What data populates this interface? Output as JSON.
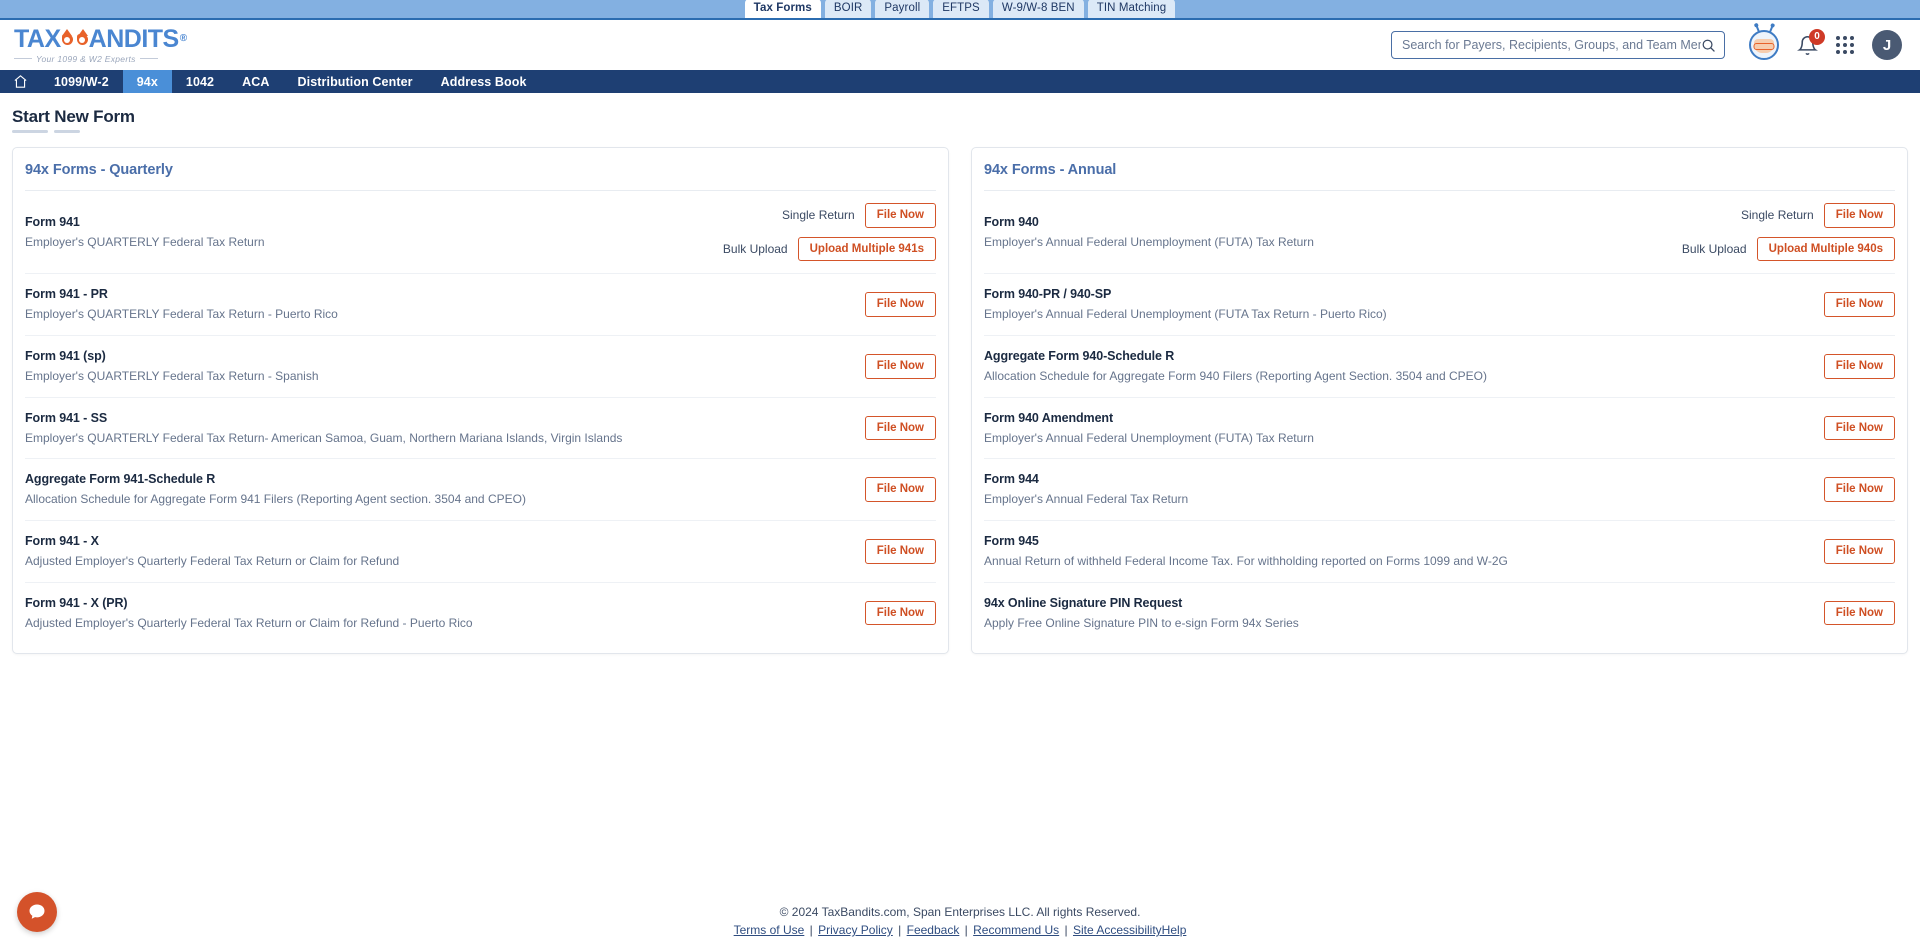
{
  "brand": {
    "name_part1": "TAX",
    "name_part2": "ANDITS",
    "trademark": "Ⓜ",
    "tagline": "Your 1099 & W2 Experts",
    "accent_orange": "#d4552a",
    "accent_blue": "#4a86d1",
    "nav_blue": "#1e3f73"
  },
  "top_tabs": [
    {
      "label": "Tax Forms",
      "active": true
    },
    {
      "label": "BOIR",
      "active": false
    },
    {
      "label": "Payroll",
      "active": false
    },
    {
      "label": "EFTPS",
      "active": false
    },
    {
      "label": "W-9/W-8 BEN",
      "active": false
    },
    {
      "label": "TIN Matching",
      "active": false
    }
  ],
  "header": {
    "search": {
      "placeholder": "Search for Payers, Recipients, Groups, and Team Members",
      "value": "",
      "icon": "search-icon"
    },
    "bot_icon": "bot-assistant-icon",
    "notifications": {
      "icon": "bell-icon",
      "count": "0"
    },
    "apps_icon": "grid-apps-icon",
    "avatar_initial": "J"
  },
  "nav": {
    "home_icon": "home-icon",
    "items": [
      {
        "label": "1099/W-2",
        "active": false
      },
      {
        "label": "94x",
        "active": true
      },
      {
        "label": "1042",
        "active": false
      },
      {
        "label": "ACA",
        "active": false
      },
      {
        "label": "Distribution Center",
        "active": false
      },
      {
        "label": "Address Book",
        "active": false
      }
    ]
  },
  "page": {
    "title": "Start New Form"
  },
  "labels": {
    "single_return": "Single Return",
    "bulk_upload": "Bulk Upload",
    "file_now": "File Now"
  },
  "quarterly": {
    "heading": "94x Forms - Quarterly",
    "rows": [
      {
        "name": "Form 941",
        "desc": "Employer's QUARTERLY Federal Tax Return",
        "single_label": "Single Return",
        "file_now": "File Now",
        "bulk_label": "Bulk Upload",
        "bulk_button": "Upload Multiple 941s"
      },
      {
        "name": "Form 941 - PR",
        "desc": "Employer's QUARTERLY Federal Tax Return - Puerto Rico",
        "file_now": "File Now"
      },
      {
        "name": "Form 941 (sp)",
        "desc": "Employer's QUARTERLY Federal Tax Return - Spanish",
        "file_now": "File Now"
      },
      {
        "name": "Form 941 - SS",
        "desc": "Employer's QUARTERLY Federal Tax Return- American Samoa, Guam, Northern Mariana Islands, Virgin Islands",
        "file_now": "File Now"
      },
      {
        "name": "Aggregate Form 941-Schedule R",
        "desc": "Allocation Schedule for Aggregate Form 941 Filers (Reporting Agent section. 3504 and CPEO)",
        "file_now": "File Now"
      },
      {
        "name": "Form 941 - X",
        "desc": "Adjusted Employer's Quarterly Federal Tax Return or Claim for Refund",
        "file_now": "File Now"
      },
      {
        "name": "Form 941 - X (PR)",
        "desc": "Adjusted Employer's Quarterly Federal Tax Return or Claim for Refund - Puerto Rico",
        "file_now": "File Now"
      }
    ]
  },
  "annual": {
    "heading": "94x Forms - Annual",
    "rows": [
      {
        "name": "Form 940",
        "desc": "Employer's Annual Federal Unemployment (FUTA) Tax Return",
        "single_label": "Single Return",
        "file_now": "File Now",
        "bulk_label": "Bulk Upload",
        "bulk_button": "Upload Multiple 940s"
      },
      {
        "name": "Form 940-PR / 940-SP",
        "desc": "Employer's Annual Federal Unemployment (FUTA Tax Return - Puerto Rico)",
        "file_now": "File Now"
      },
      {
        "name": "Aggregate Form 940-Schedule R",
        "desc": "Allocation Schedule for Aggregate Form 940 Filers (Reporting Agent Section. 3504 and CPEO)",
        "file_now": "File Now"
      },
      {
        "name": "Form 940 Amendment",
        "desc": "Employer's Annual Federal Unemployment (FUTA) Tax Return",
        "file_now": "File Now"
      },
      {
        "name": "Form 944",
        "desc": "Employer's Annual Federal Tax Return",
        "file_now": "File Now"
      },
      {
        "name": "Form 945",
        "desc": "Annual Return of withheld Federal Income Tax. For withholding reported on Forms 1099 and W-2G",
        "file_now": "File Now"
      },
      {
        "name": "94x Online Signature PIN Request",
        "desc": "Apply Free Online Signature PIN to e-sign Form 94x Series",
        "file_now": "File Now"
      }
    ]
  },
  "footer": {
    "copyright": "© 2024 TaxBandits.com, Span Enterprises LLC. All rights Reserved.",
    "links": [
      "Terms of Use",
      "Privacy Policy",
      "Feedback",
      "Recommend Us",
      "Site AccessibilityHelp"
    ],
    "separator": "|"
  },
  "chat": {
    "icon": "chat-bubble-icon"
  }
}
